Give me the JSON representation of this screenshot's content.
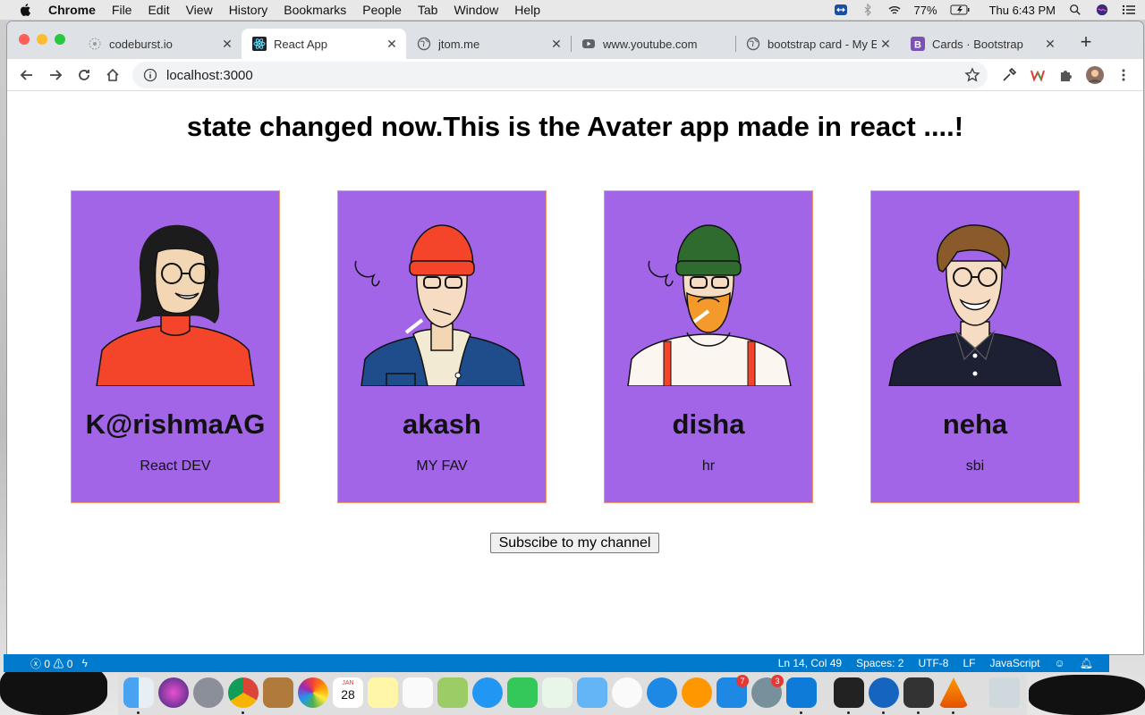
{
  "menubar": {
    "app": "Chrome",
    "items": [
      "File",
      "Edit",
      "View",
      "History",
      "Bookmarks",
      "People",
      "Tab",
      "Window",
      "Help"
    ],
    "battery": "77%",
    "clock": "Thu 6:43 PM"
  },
  "browser": {
    "tabs": [
      {
        "title": "codeburst.io",
        "icon": "codeburst-icon"
      },
      {
        "title": "React App",
        "icon": "react-icon"
      },
      {
        "title": "jtom.me",
        "icon": "globe-icon"
      },
      {
        "title": "www.youtube.com",
        "icon": "youtube-icon"
      },
      {
        "title": "bootstrap card - My E",
        "icon": "globe-icon"
      },
      {
        "title": "Cards · Bootstrap",
        "icon": "bootstrap-icon"
      }
    ],
    "active_tab_index": 1,
    "url": "localhost:3000"
  },
  "page": {
    "heading": "state changed now.This is the Avater app made in react ....!",
    "cards": [
      {
        "name": "K@rishmaAG",
        "role": "React DEV",
        "avatar": "woman-glasses-avatar"
      },
      {
        "name": "akash",
        "role": "MY FAV",
        "avatar": "man-beanie-red-avatar"
      },
      {
        "name": "disha",
        "role": "hr",
        "avatar": "bearded-man-green-beanie-avatar"
      },
      {
        "name": "neha",
        "role": "sbi",
        "avatar": "man-glasses-shirt-avatar"
      }
    ],
    "button_label": "Subscibe to my channel",
    "card_color": "#a265e8",
    "card_border_color": "#f39a6b"
  },
  "statusbar": {
    "errors": "0",
    "warnings": "0",
    "position": "Ln 14, Col 49",
    "spaces": "Spaces: 2",
    "encoding": "UTF-8",
    "eol": "LF",
    "language": "JavaScript"
  },
  "dock": {
    "badges": {
      "appstore": "7",
      "settings": "3"
    },
    "calendar_month": "JAN",
    "calendar_day": "28"
  }
}
